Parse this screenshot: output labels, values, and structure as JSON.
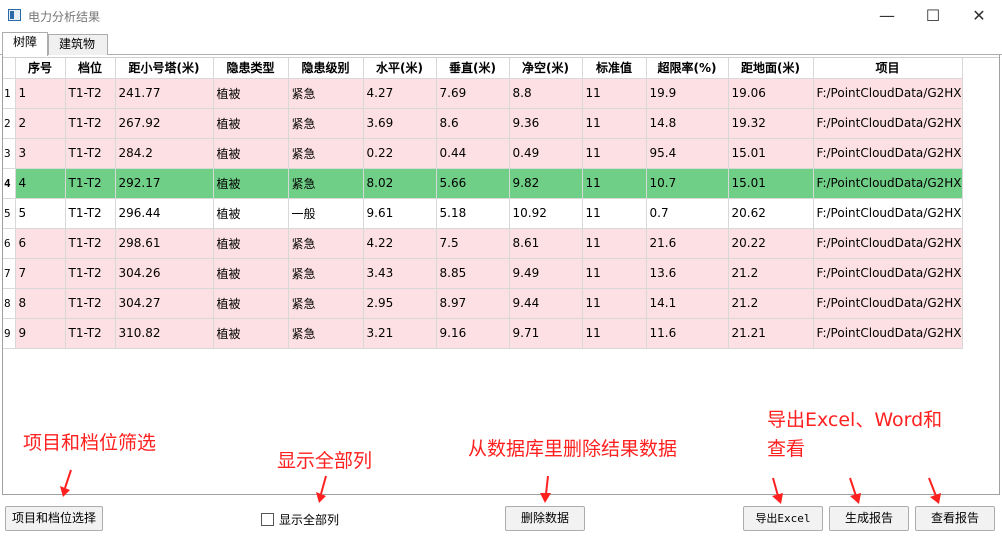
{
  "window": {
    "title": "电力分析结果",
    "icon": "app-window-icon",
    "controls": [
      "minimize",
      "maximize",
      "close"
    ]
  },
  "tabs": [
    {
      "label": "树障",
      "active": true
    },
    {
      "label": "建筑物",
      "active": false
    }
  ],
  "chart_data": {
    "type": "table",
    "columns": [
      "序号",
      "档位",
      "距小号塔(米)",
      "隐患类型",
      "隐患级别",
      "水平(米)",
      "垂直(米)",
      "净空(米)",
      "标准值",
      "超限率(%)",
      "距地面(米)",
      "项目"
    ],
    "rows": [
      {
        "row_header": "1",
        "highlight": "pink",
        "cells": [
          "1",
          "T1-T2",
          "241.77",
          "植被",
          "紧急",
          "4.27",
          "7.69",
          "8.8",
          "11",
          "19.9",
          "19.06",
          "F:/PointCloudData/G2HX"
        ]
      },
      {
        "row_header": "2",
        "highlight": "pink",
        "cells": [
          "2",
          "T1-T2",
          "267.92",
          "植被",
          "紧急",
          "3.69",
          "8.6",
          "9.36",
          "11",
          "14.8",
          "19.32",
          "F:/PointCloudData/G2HX"
        ]
      },
      {
        "row_header": "3",
        "highlight": "pink",
        "cells": [
          "3",
          "T1-T2",
          "284.2",
          "植被",
          "紧急",
          "0.22",
          "0.44",
          "0.49",
          "11",
          "95.4",
          "15.01",
          "F:/PointCloudData/G2HX"
        ]
      },
      {
        "row_header": "4",
        "highlight": "green",
        "cells": [
          "4",
          "T1-T2",
          "292.17",
          "植被",
          "紧急",
          "8.02",
          "5.66",
          "9.82",
          "11",
          "10.7",
          "15.01",
          "F:/PointCloudData/G2HX"
        ]
      },
      {
        "row_header": "5",
        "highlight": "white",
        "cells": [
          "5",
          "T1-T2",
          "296.44",
          "植被",
          "一般",
          "9.61",
          "5.18",
          "10.92",
          "11",
          "0.7",
          "20.62",
          "F:/PointCloudData/G2HX"
        ]
      },
      {
        "row_header": "6",
        "highlight": "pink",
        "cells": [
          "6",
          "T1-T2",
          "298.61",
          "植被",
          "紧急",
          "4.22",
          "7.5",
          "8.61",
          "11",
          "21.6",
          "20.22",
          "F:/PointCloudData/G2HX"
        ]
      },
      {
        "row_header": "7",
        "highlight": "pink",
        "cells": [
          "7",
          "T1-T2",
          "304.26",
          "植被",
          "紧急",
          "3.43",
          "8.85",
          "9.49",
          "11",
          "13.6",
          "21.2",
          "F:/PointCloudData/G2HX"
        ]
      },
      {
        "row_header": "8",
        "highlight": "pink",
        "cells": [
          "8",
          "T1-T2",
          "304.27",
          "植被",
          "紧急",
          "2.95",
          "8.97",
          "9.44",
          "11",
          "14.1",
          "21.2",
          "F:/PointCloudData/G2HX"
        ]
      },
      {
        "row_header": "9",
        "highlight": "pink",
        "cells": [
          "9",
          "T1-T2",
          "310.82",
          "植被",
          "紧急",
          "3.21",
          "9.16",
          "9.71",
          "11",
          "11.6",
          "21.21",
          "F:/PointCloudData/G2HX"
        ]
      }
    ]
  },
  "colors": {
    "row_pink": "#fde0e3",
    "row_green": "#6fcf86",
    "annotation_red": "#ff2020"
  },
  "annotations": {
    "filter": "项目和档位筛选",
    "show_all": "显示全部列",
    "delete": "从数据库里删除结果数据",
    "export_line1": "导出Excel、Word和",
    "export_line2": "查看"
  },
  "toolbar": {
    "select_label": "项目和档位选择",
    "show_all_label": "显示全部列",
    "show_all_checked": false,
    "delete_label": "删除数据",
    "export_label": "导出Excel",
    "report_label": "生成报告",
    "view_label": "查看报告"
  }
}
